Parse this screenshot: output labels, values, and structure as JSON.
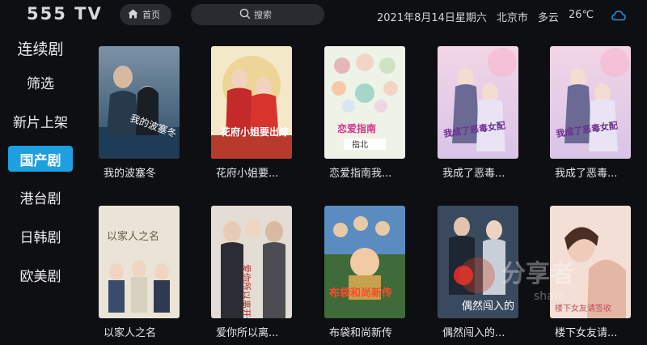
{
  "header": {
    "logo": "555 TV",
    "home_label": "首页",
    "search_placeholder": "搜索",
    "date": "2021年8月14日星期六",
    "city": "北京市",
    "weather": "多云",
    "temperature": "26℃",
    "icons": {
      "home": "home-icon",
      "search": "search-icon",
      "weather": "cloud-icon"
    },
    "accent_color": "#1ea0e0"
  },
  "sidebar": {
    "items": [
      {
        "label": "连续剧",
        "active": false
      },
      {
        "label": "筛选",
        "active": false
      },
      {
        "label": "新片上架",
        "active": false
      },
      {
        "label": "国产剧",
        "active": true
      },
      {
        "label": "港台剧",
        "active": false
      },
      {
        "label": "日韩剧",
        "active": false
      },
      {
        "label": "欧美剧",
        "active": false
      }
    ]
  },
  "videos": [
    {
      "title": "我的波塞冬",
      "poster_text": "我的波塞冬"
    },
    {
      "title": "花府小姐要...",
      "poster_text": "花府小姐要出嫁"
    },
    {
      "title": "恋爱指南我...",
      "poster_text": "恋爱指南"
    },
    {
      "title": "我成了恶毒...",
      "poster_text": "我成了恶毒女配"
    },
    {
      "title": "我成了恶毒...",
      "poster_text": "我成了恶毒女配"
    },
    {
      "title": "以家人之名",
      "poster_text": "以家人之名"
    },
    {
      "title": "爱你所以离...",
      "poster_text": "爱你所以离开你"
    },
    {
      "title": "布袋和尚新传",
      "poster_text": "布袋和尚新传"
    },
    {
      "title": "偶然闯入的...",
      "poster_text": "偶然闯入的"
    },
    {
      "title": "楼下女友请...",
      "poster_text": "楼下女友请签收"
    }
  ],
  "watermark": {
    "text": "分享者",
    "subtext": "share"
  }
}
